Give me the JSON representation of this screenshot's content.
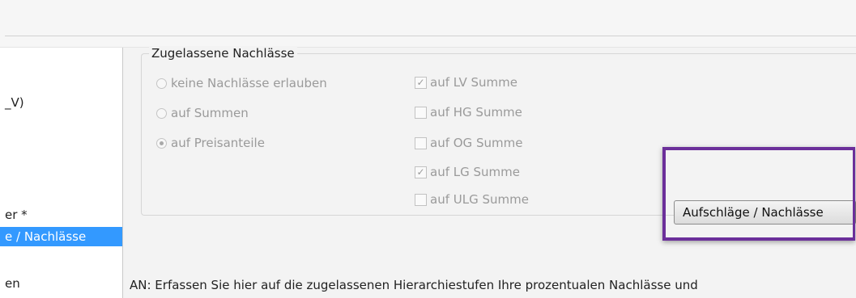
{
  "left": {
    "items": [
      {
        "label": "_V)"
      },
      {
        "label": "er *"
      },
      {
        "label": "e / Nachlässe"
      },
      {
        "label": "en"
      }
    ]
  },
  "group": {
    "legend": "Zugelassene Nachlässe",
    "radios": [
      {
        "label": "keine Nachlässe erlauben",
        "checked": false
      },
      {
        "label": "auf Summen",
        "checked": false
      },
      {
        "label": "auf Preisanteile",
        "checked": true
      }
    ],
    "checks": [
      {
        "label": "auf LV Summe",
        "checked": true
      },
      {
        "label": "auf HG Summe",
        "checked": false
      },
      {
        "label": "auf OG Summe",
        "checked": false
      },
      {
        "label": "auf LG Summe",
        "checked": true
      },
      {
        "label": "auf ULG Summe",
        "checked": false
      }
    ]
  },
  "button": {
    "label": "Aufschläge / Nachlässe"
  },
  "info": {
    "text": "AN: Erfassen Sie hier auf die zugelassenen Hierarchiestufen Ihre prozentualen Nachlässe und"
  },
  "colors": {
    "selection": "#3399ff",
    "highlight": "#6b2f9a"
  }
}
